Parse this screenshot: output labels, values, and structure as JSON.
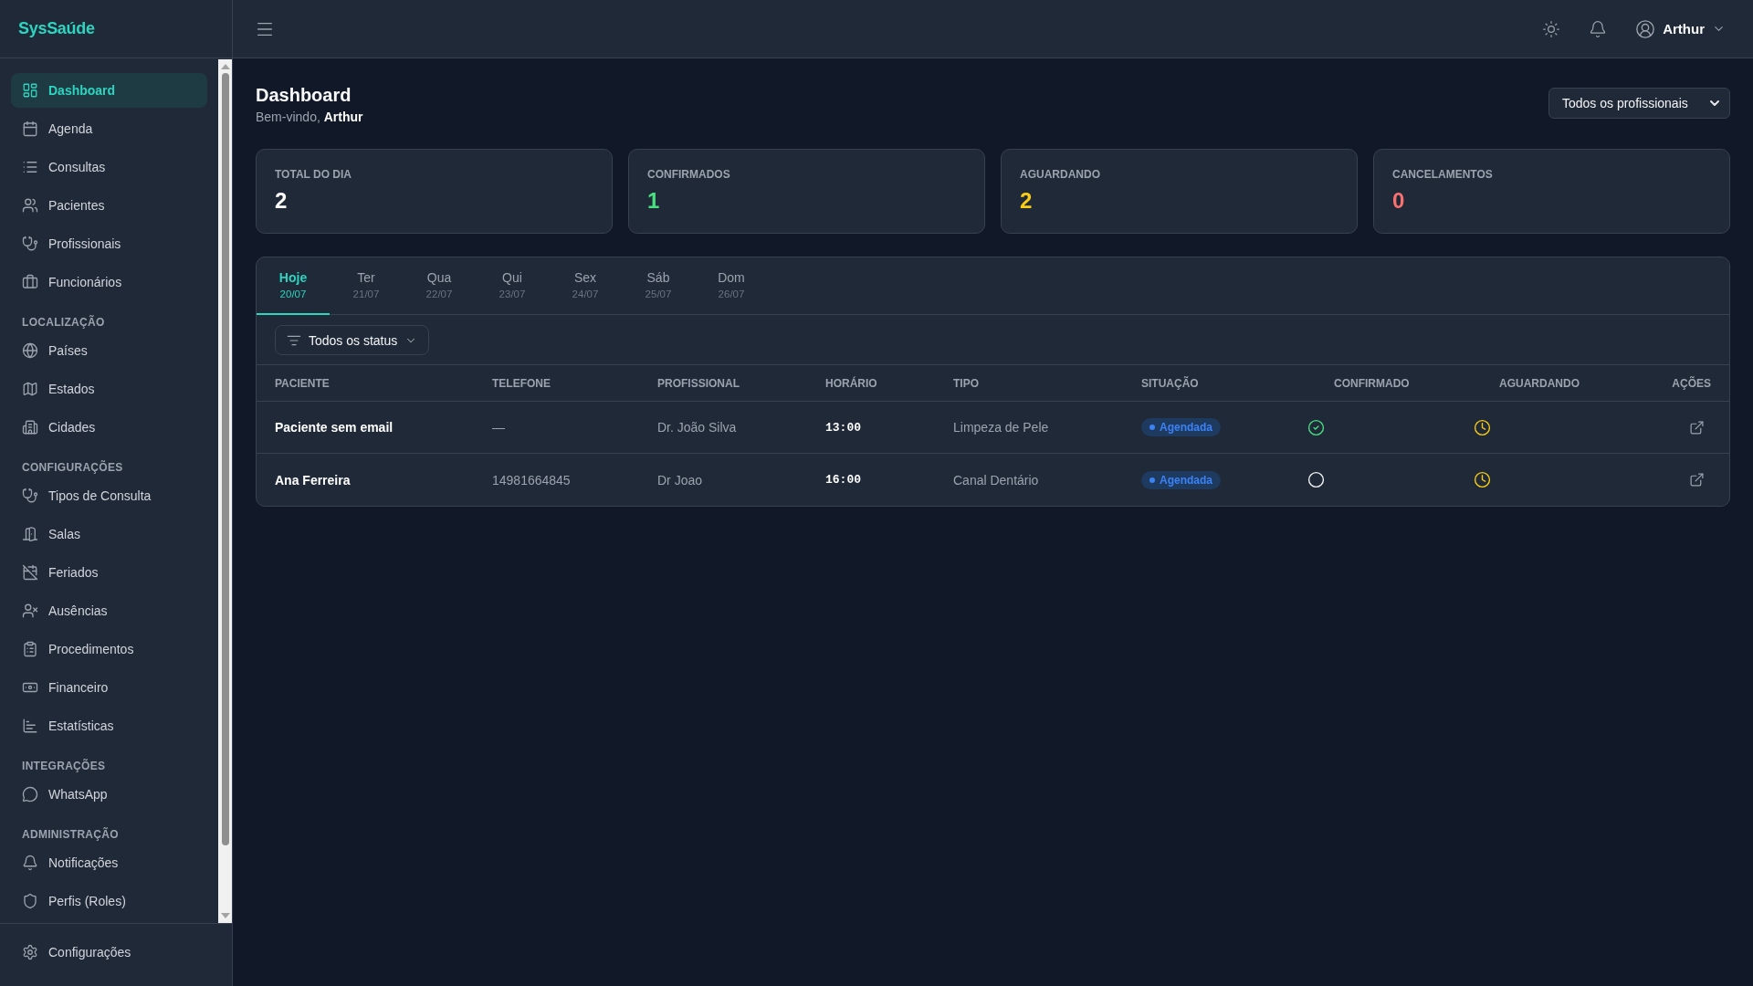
{
  "sidebar": {
    "logo": "SysSaúde",
    "groups": [
      {
        "items": [
          {
            "label": "Dashboard",
            "selected": true
          },
          {
            "label": "Agenda",
            "selected": false
          },
          {
            "label": "Consultas",
            "selected": false
          },
          {
            "label": "Pacientes",
            "selected": false
          },
          {
            "label": "Profissionais",
            "selected": false
          },
          {
            "label": "Funcionários",
            "selected": false
          }
        ]
      },
      {
        "title": "LOCALIZAÇÃO",
        "items": [
          {
            "label": "Países",
            "selected": false
          },
          {
            "label": "Estados",
            "selected": false
          },
          {
            "label": "Cidades",
            "selected": false
          }
        ]
      },
      {
        "title": "CONFIGURAÇÕES",
        "items": [
          {
            "label": "Tipos de Consulta",
            "selected": false
          },
          {
            "label": "Salas",
            "selected": false
          },
          {
            "label": "Feriados",
            "selected": false
          },
          {
            "label": "Ausências",
            "selected": false
          },
          {
            "label": "Procedimentos",
            "selected": false
          },
          {
            "label": "Financeiro",
            "selected": false
          },
          {
            "label": "Estatísticas",
            "selected": false
          }
        ]
      },
      {
        "title": "INTEGRAÇÕES",
        "items": [
          {
            "label": "WhatsApp",
            "selected": false
          }
        ]
      },
      {
        "title": "ADMINISTRAÇÃO",
        "items": [
          {
            "label": "Notificações",
            "selected": false
          },
          {
            "label": "Perfis (Roles)",
            "selected": false
          }
        ]
      }
    ],
    "footer_item": {
      "label": "Configurações",
      "selected": false
    }
  },
  "header": {
    "user_name": "Arthur"
  },
  "page": {
    "title": "Dashboard",
    "greeting": "Bem-vindo, **Arthur**"
  },
  "professional_filter": {
    "value": "Todos os profissionais"
  },
  "stats": [
    {
      "label": "TOTAL DO DIA",
      "value": "2",
      "color": "#ffffff"
    },
    {
      "label": "CONFIRMADOS",
      "value": "1",
      "color": "#4ade80"
    },
    {
      "label": "AGUARDANDO",
      "value": "2",
      "color": "#facc15"
    },
    {
      "label": "CANCELAMENTOS",
      "value": "0",
      "color": "#f87171"
    }
  ],
  "day_tabs": [
    {
      "day": "Hoje",
      "date": "20/07",
      "selected": true
    },
    {
      "day": "Ter",
      "date": "21/07",
      "selected": false
    },
    {
      "day": "Qua",
      "date": "22/07",
      "selected": false
    },
    {
      "day": "Qui",
      "date": "23/07",
      "selected": false
    },
    {
      "day": "Sex",
      "date": "24/07",
      "selected": false
    },
    {
      "day": "Sáb",
      "date": "25/07",
      "selected": false
    },
    {
      "day": "Dom",
      "date": "26/07",
      "selected": false
    }
  ],
  "status_filter": {
    "value": "Todos os status"
  },
  "table": {
    "columns": [
      "PACIENTE",
      "TELEFONE",
      "PROFISSIONAL",
      "HORÁRIO",
      "TIPO",
      "SITUAÇÃO",
      "CONFIRMADO",
      "AGUARDANDO",
      "AÇÕES"
    ],
    "rows": [
      {
        "patient": "Paciente sem email",
        "phone": "—",
        "professional": "Dr. João Silva",
        "time": "13:00",
        "type": "Limpeza de Pele",
        "status": "Agendada",
        "confirmed": true,
        "waiting": true
      },
      {
        "patient": "Ana Ferreira",
        "phone": "14981664845",
        "professional": "Dr Joao",
        "time": "16:00",
        "type": "Canal Dentário",
        "status": "Agendada",
        "confirmed": false,
        "waiting": true
      }
    ]
  }
}
